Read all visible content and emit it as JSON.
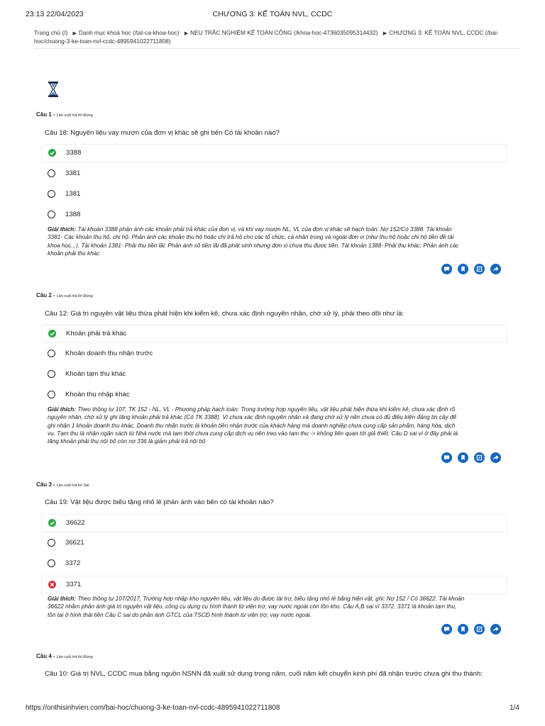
{
  "print_header": {
    "datetime": "23:13 22/04/2023",
    "title": "CHƯƠNG 3: KẾ TOÁN NVL, CCDC"
  },
  "breadcrumb": {
    "items": [
      "Trang chủ (/)",
      "Danh mục khoá học (/tat-ca-khoa-hoc)",
      "NEU TRẮC NGHIỆM KẾ TOÁN CÔNG (/khoa-hoc-4736035095314432)",
      "CHƯƠNG 3: KẾ TOÁN NVL, CCDC (/bai-",
      "hoc/chuong-3-ke-toan-nvl-ccdc-4895941022711808)"
    ]
  },
  "icons": {
    "timer": "hourglass-icon",
    "actions": [
      "comment-icon",
      "bookmark-icon",
      "note-icon",
      "share-icon"
    ]
  },
  "colors": {
    "correct": "#28a745",
    "wrong": "#dc3545",
    "action": "#1565c0"
  },
  "questions": [
    {
      "label": "Câu 1 -",
      "status": "Lần cuối trả lời Đúng",
      "text": "Câu 18: Nguyên liệu vay mượn của đơn vị khác sẽ ghi bên Có tài khoản nào?",
      "options": [
        {
          "text": "3388",
          "state": "correct"
        },
        {
          "text": "3381",
          "state": "none"
        },
        {
          "text": "1381",
          "state": "none"
        },
        {
          "text": "1388",
          "state": "none"
        }
      ],
      "explanation_label": "Giải thích:",
      "explanation_lines": [
        "Tài khoản 3388 phản ánh các khoản phải trả khác của đơn vị, và khi vay mượn NL, VL của đơn vị khác sẽ hạch toán: Nợ 152/Có 3388. Tài khoản",
        "3381- Các khoản thu hộ, chi hộ: Phản ánh các khoản thu hộ hoặc chi trả hộ cho các tổ chức, cá nhân trong và ngoài đơn vị (như thu hộ hoặc chi hộ tiền đề tài",
        "khoa học...). Tài khoản 1381- Phải thu tiền lãi: Phản ánh số tiền lãi đã phát sinh nhưng đơn vị chưa thu được tiền. Tài khoản 1388- Phải thu khác: Phản ánh các",
        "khoản phải thu khác"
      ]
    },
    {
      "label": "Câu 2 -",
      "status": "Lần cuối trả lời Đúng",
      "text": "Câu 12: Giá trị nguyên vật liệu thừa phát hiện khi kiểm kê, chưa xác định nguyên nhân, chờ xử lý, phải theo dõi như là:",
      "options": [
        {
          "text": "Khoản phải trả khác",
          "state": "correct"
        },
        {
          "text": "Khoản doanh thu nhận trước",
          "state": "none"
        },
        {
          "text": "Khoản tạm thu khác",
          "state": "none"
        },
        {
          "text": "Khoản thu nhập khác",
          "state": "none"
        }
      ],
      "explanation_label": "Giải thích:",
      "explanation_lines": [
        "Theo thông tư 107, TK 152 - NL, VL - Phương pháp hạch toán: Trong trường hợp nguyên liệu, vật liệu phát hiện thừa khi kiểm kê, chưa xác định rõ",
        "nguyên nhân, chờ xử lý ghi tăng khoản phải trả khác (Có TK 3388). Vì chưa xác định nguyên nhân và đang chờ xử lý nên chưa có đủ điều kiện đảng tin cậy để",
        "ghi nhận 1 khoản doanh thu khác. Doanh thu nhận trước là khoản tiền nhận trước của khách hàng mà doanh nghiệp chưa cung cấp sản phẩm, hàng hóa, dịch",
        "vụ. Tạm thu là nhận ngân sách từ Nhà nước mà tạm thời chưa cung cấp dịch vụ nên treo vào tạm thu -> không liên quan tới giả thiết. Câu D sai vì ở đây phải là",
        "tăng khoản phải thu nội bộ còn nợ 336 là giảm phải trả nội bộ"
      ]
    },
    {
      "label": "Câu 3 -",
      "status": "Lần cuối trả lời Sai",
      "text": "Câu 19: Vật liệu được biếu tặng nhỏ lẻ phản ánh vào bên có tài khoản nào?",
      "options": [
        {
          "text": "36622",
          "state": "correct"
        },
        {
          "text": "36621",
          "state": "none"
        },
        {
          "text": "3372",
          "state": "none"
        },
        {
          "text": "3371",
          "state": "wrong"
        }
      ],
      "explanation_label": "Giải thích:",
      "explanation_lines": [
        "Theo thông tư 107/2017, Trường hợp nhập kho nguyên liệu, vật liệu do được tài trợ, biếu tặng nhỏ lẻ bằng hiện vật, ghi: Nợ 152 / Có 36622. Tài khoản",
        "36622 nhằm phản ánh giá trị nguyên vật liệu, công cụ dụng cụ hình thành từ viện trợ, vay nước ngoài còn tồn kho. Câu A,B sai vì 3372, 3371 là khoản tạm thu,",
        "tồn tại ở hình thái tiền Câu C sai do phản ánh GTCL của TSCĐ hình thành từ viện trợ, vay nước ngoài."
      ]
    },
    {
      "label": "Câu 4 -",
      "status": "Lần cuối trả lời Đúng",
      "text": "Câu 10: Giá trị NVL, CCDC mua bằng nguồn NSNN đã xuất sử dụng trong năm, cuối năm kết chuyển kinh phí đã nhận trước chưa ghi thu thành:"
    }
  ],
  "footer": {
    "url": "https://onthisinhvien.com/bai-hoc/chuong-3-ke-toan-nvl-ccdc-4895941022711808",
    "page": "1/4"
  }
}
